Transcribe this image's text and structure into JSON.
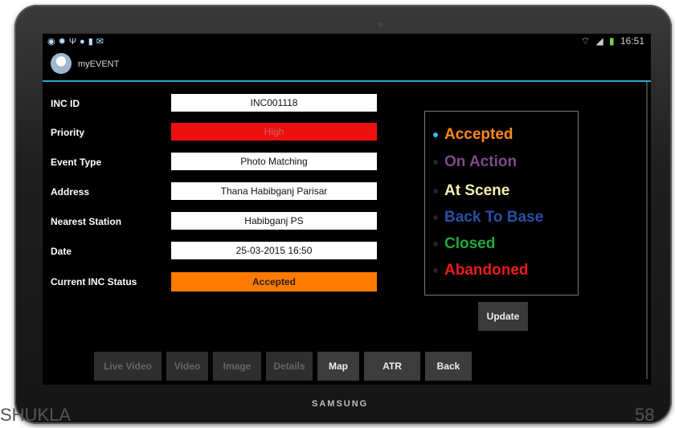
{
  "statusbar": {
    "left_icons": [
      "notification-icon",
      "gps-icon",
      "usb-icon",
      "app-icon",
      "sd-icon",
      "mail-icon"
    ],
    "right_icons": [
      "wifi-icon",
      "signal-icon",
      "battery-icon"
    ],
    "time": "16:51"
  },
  "app": {
    "title": "myEVENT"
  },
  "form": {
    "inc_id": {
      "label": "INC ID",
      "value": "INC001118"
    },
    "priority": {
      "label": "Priority",
      "value": "High",
      "color": "#ee1010"
    },
    "event_type": {
      "label": "Event Type",
      "value": "Photo Matching"
    },
    "address": {
      "label": "Address",
      "value": "Thana Habibganj Parisar"
    },
    "nearest_station": {
      "label": "Nearest Station",
      "value": "Habibganj PS"
    },
    "date": {
      "label": "Date",
      "value": "25-03-2015 16:50"
    },
    "current_status": {
      "label": "Current INC Status",
      "value": "Accepted",
      "color": "#ff7a00"
    }
  },
  "status_options": [
    {
      "label": "Accepted",
      "color": "#ff8a1a",
      "selected": true
    },
    {
      "label": "On Action",
      "color": "#7a4a8a",
      "selected": false
    },
    {
      "label": "At Scene",
      "color": "#f4f0b0",
      "selected": false
    },
    {
      "label": "Back To Base",
      "color": "#2a4ea8",
      "selected": false
    },
    {
      "label": "Closed",
      "color": "#1fa83a",
      "selected": false
    },
    {
      "label": "Abandoned",
      "color": "#ee1b1b",
      "selected": false
    }
  ],
  "update_button": "Update",
  "bottom_buttons": [
    {
      "label": "Live Video",
      "enabled": false
    },
    {
      "label": "Video",
      "enabled": false
    },
    {
      "label": "Image",
      "enabled": false
    },
    {
      "label": "Details",
      "enabled": false
    },
    {
      "label": "Map",
      "enabled": true
    },
    {
      "label": "ATR",
      "enabled": true
    },
    {
      "label": "Back",
      "enabled": true
    }
  ],
  "device_brand": "SAMSUNG",
  "caption_left": "SHUKLA",
  "caption_right": "58"
}
